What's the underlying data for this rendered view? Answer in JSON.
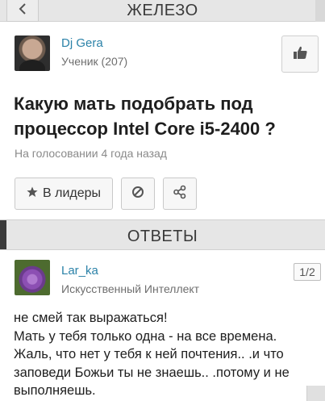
{
  "header": {
    "title": "ЖЕЛЕЗО",
    "back_icon": "chevron-left-icon"
  },
  "question": {
    "author": {
      "name": "Dj Gera",
      "rank": "Ученик (207)"
    },
    "title": "Какую мать подобрать под процессор Intel Core i5-2400 ?",
    "meta": "На голосовании 4 года назад",
    "actions": {
      "leaders_label": "В лидеры",
      "leaders_icon": "star-icon",
      "block_icon": "block-icon",
      "share_icon": "share-icon",
      "like_icon": "thumbs-up-icon"
    }
  },
  "answers": {
    "section_title": "ОТВЕТЫ",
    "items": [
      {
        "author": {
          "name": "Lar_ka",
          "rank": "Искусственный Интеллект"
        },
        "pager": "1/2",
        "lines": [
          "не смей так выражаться!",
          "Мать у тебя только одна - на все времена.",
          "Жаль, что нет у тебя к ней почтения.. .и что",
          "заповеди Божьи ты не знаешь.. .потому и не",
          "выполняешь."
        ]
      }
    ]
  }
}
